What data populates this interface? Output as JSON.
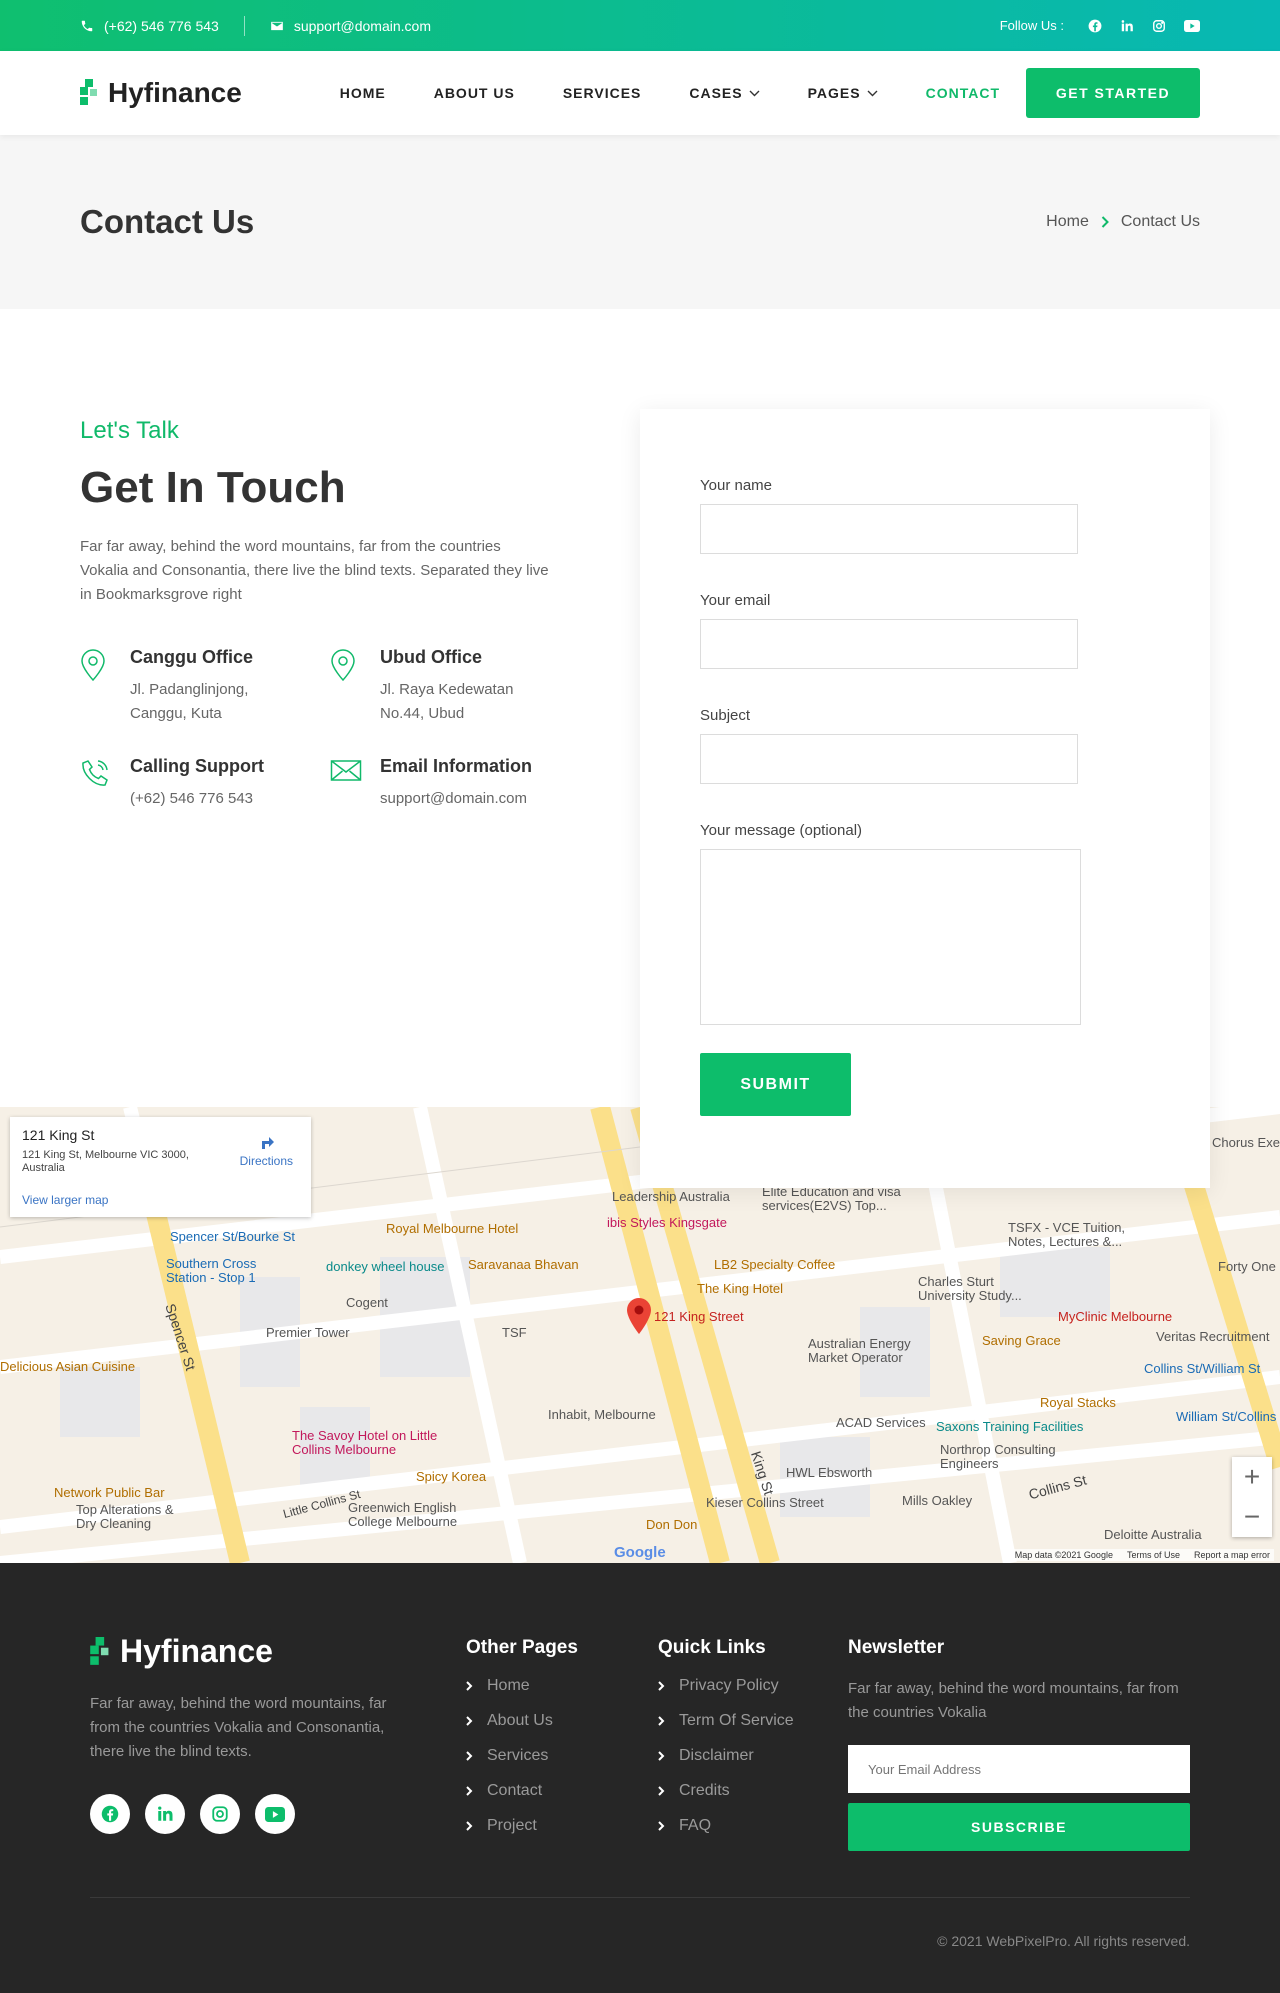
{
  "topbar": {
    "phone": "(+62) 546 776 543",
    "email": "support@domain.com",
    "follow_label": "Follow Us :",
    "social_icons": [
      "facebook-icon",
      "linkedin-icon",
      "instagram-icon",
      "youtube-icon"
    ]
  },
  "nav": {
    "brand": "Hyfinance",
    "items": [
      {
        "label": "HOME",
        "dropdown": false
      },
      {
        "label": "ABOUT US",
        "dropdown": false
      },
      {
        "label": "SERVICES",
        "dropdown": false
      },
      {
        "label": "CASES",
        "dropdown": true
      },
      {
        "label": "PAGES",
        "dropdown": true
      },
      {
        "label": "CONTACT",
        "dropdown": false,
        "active": true
      }
    ],
    "cta": "GET STARTED"
  },
  "hero": {
    "title": "Contact Us",
    "breadcrumb": [
      "Home",
      "Contact Us"
    ]
  },
  "contact": {
    "eyebrow": "Let's Talk",
    "heading": "Get In Touch",
    "lead": "Far far away, behind the word mountains, far from the countries Vokalia and Consonantia, there live the blind texts. Separated they live in Bookmarksgrove right",
    "cards": [
      {
        "icon": "map-pin-icon",
        "title": "Canggu Office",
        "lines": [
          "Jl. Padanglinjong,",
          "Canggu, Kuta"
        ]
      },
      {
        "icon": "map-pin-icon",
        "title": "Ubud Office",
        "lines": [
          "Jl. Raya Kedewatan",
          "No.44, Ubud"
        ]
      },
      {
        "icon": "phone-icon",
        "title": "Calling Support",
        "lines": [
          "(+62) 546 776 543"
        ]
      },
      {
        "icon": "mail-icon",
        "title": "Email Information",
        "lines": [
          "support@domain.com"
        ]
      }
    ]
  },
  "form": {
    "name_label": "Your name",
    "email_label": "Your email",
    "subject_label": "Subject",
    "message_label": "Your message (optional)",
    "name_value": "",
    "email_value": "",
    "subject_value": "",
    "message_value": "",
    "submit": "SUBMIT"
  },
  "map": {
    "place_title": "121 King St",
    "place_address": "121 King St, Melbourne VIC 3000, Australia",
    "directions": "Directions",
    "larger": "View larger map",
    "marker_label": "121 King Street",
    "labels": [
      "Royal Melbourne Hotel",
      "ibis Styles Kingsgate",
      "Saravanaa Bhavan",
      "LB2 Specialty Coffee",
      "The King Hotel",
      "Spencer St/Bourke St",
      "Southern Cross Station - Stop 1",
      "donkey wheel house",
      "Cogent",
      "Premier Tower",
      "TSF",
      "Delicious Asian Cuisine",
      "The Savoy Hotel on Little Collins Melbourne",
      "Spicy Korea",
      "Network Public Bar",
      "Top Alterations & Dry Cleaning",
      "Greenwich English College Melbourne",
      "Inhabit, Melbourne",
      "Australian Energy Market Operator",
      "ACAD Services",
      "HWL Ebsworth",
      "Kieser Collins Street",
      "Don Don",
      "Mills Oakley",
      "Northrop Consulting Engineers",
      "Saxons Training Facilities",
      "Royal Stacks",
      "Saving Grace",
      "MyClinic Melbourne",
      "Veritas Recruitment",
      "Collins St/William St",
      "William St/Collins",
      "Charles Sturt University Study...",
      "TSFX - VCE Tuition, Notes, Lectures &...",
      "Forty One",
      "Elite Education and visa services(E2VS) Top...",
      "Leadership Australia",
      "Chorus Exe",
      "Deloitte Australia",
      "Spencer St",
      "King St",
      "Little Collins St",
      "Collins St"
    ],
    "zoom_in": "+",
    "zoom_out": "−",
    "footer": [
      "Map data ©2021 Google",
      "Terms of Use",
      "Report a map error"
    ],
    "google": "Google"
  },
  "footer": {
    "brand": "Hyfinance",
    "desc": "Far far away, behind the word mountains, far from the countries Vokalia and Consonantia, there live the blind texts.",
    "social_icons": [
      "facebook-icon",
      "linkedin-icon",
      "instagram-icon",
      "youtube-icon"
    ],
    "other_title": "Other Pages",
    "other": [
      "Home",
      "About Us",
      "Services",
      "Contact",
      "Project"
    ],
    "quick_title": "Quick Links",
    "quick": [
      "Privacy Policy",
      "Term Of Service",
      "Disclaimer",
      "Credits",
      "FAQ"
    ],
    "news_title": "Newsletter",
    "news_desc": "Far far away, behind the word mountains, far from the countries Vokalia",
    "news_placeholder": "Your Email Address",
    "subscribe": "SUBSCRIBE",
    "copyright": "© 2021 WebPixelPro. All rights reserved."
  },
  "colors": {
    "accent": "#0dbd6b",
    "teal": "#08b8b4",
    "dark": "#262626"
  }
}
